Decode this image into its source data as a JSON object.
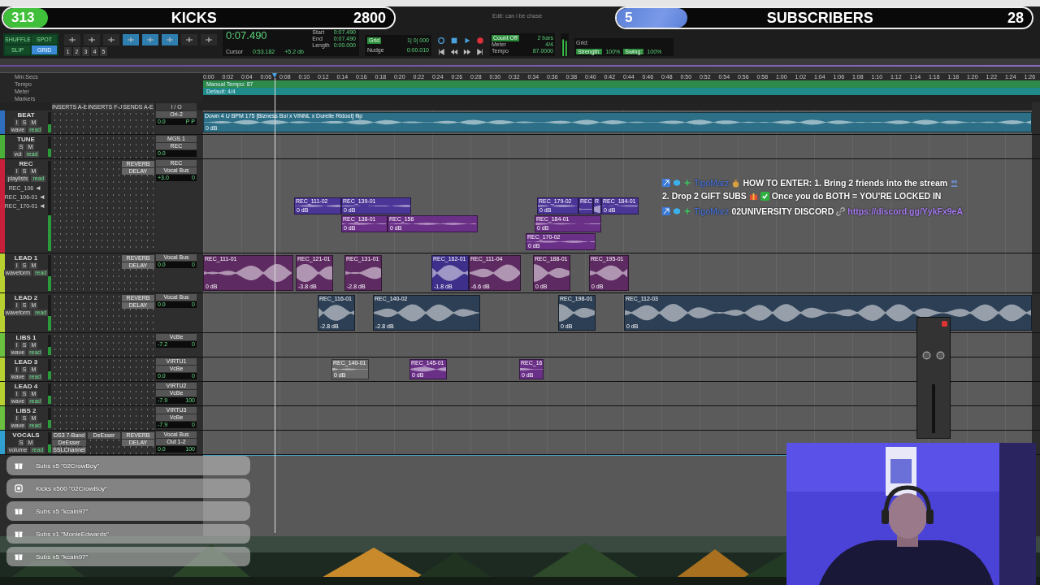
{
  "stream_goals": [
    {
      "kind": "kicks",
      "count": "313",
      "label": "KICKS",
      "target": "2800",
      "level": 0.115
    },
    {
      "kind": "subs",
      "count": "5",
      "label": "SUBSCRIBERS",
      "target": "28",
      "level": 0.17
    }
  ],
  "toolbar": {
    "window_title": "Edit: can i be chase",
    "edit_modes": [
      {
        "label": "SHUFFLE",
        "selected": false
      },
      {
        "label": "SPOT",
        "selected": false
      },
      {
        "label": "SLIP",
        "selected": false
      },
      {
        "label": "GRID",
        "selected": true
      }
    ],
    "zoom_presets": [
      "1",
      "2",
      "3",
      "4",
      "5"
    ],
    "counter": "0:07.490",
    "cursor": {
      "label": "Cursor",
      "value": "0:53.182"
    },
    "gain": "+5.2 db",
    "selection": [
      {
        "label": "Start",
        "value": "0:07.490"
      },
      {
        "label": "End",
        "value": "0:07.490"
      },
      {
        "label": "Length",
        "value": "0:00.000"
      }
    ],
    "grid": {
      "label": "Grid",
      "value": "1| 0| 000"
    },
    "nudge": {
      "label": "Nudge",
      "value": "0:00.010"
    },
    "count_off": [
      {
        "label": "Count Off",
        "value": "2 bars"
      },
      {
        "label": "Meter",
        "value": "4/4"
      },
      {
        "label": "Tempo",
        "value": "87.0000"
      }
    ],
    "groove": [
      {
        "label": "Strength:",
        "value": "100%"
      },
      {
        "label": "Swing:",
        "value": "100%"
      }
    ],
    "groove_grid": "Grid:"
  },
  "rulers": [
    {
      "label": "Min:Secs",
      "kind": "time"
    },
    {
      "label": "Tempo",
      "kind": "tempo",
      "text": "Manual Tempo: 87"
    },
    {
      "label": "Meter",
      "kind": "meter",
      "text": "Default: 4/4"
    },
    {
      "label": "Markers",
      "kind": "markers"
    }
  ],
  "ruler_ticks": [
    "0:00",
    "0:02",
    "0:04",
    "0:06",
    "0:08",
    "0:10",
    "0:12",
    "0:14",
    "0:16",
    "0:18",
    "0:20",
    "0:22",
    "0:24",
    "0:26",
    "0:28",
    "0:30",
    "0:32",
    "0:34",
    "0:36",
    "0:38",
    "0:40",
    "0:42",
    "0:44",
    "0:46",
    "0:48",
    "0:50",
    "0:52",
    "0:54",
    "0:56",
    "0:58",
    "1:00",
    "1:02",
    "1:04",
    "1:06",
    "1:08",
    "1:10",
    "1:12",
    "1:14",
    "1:16",
    "1:18",
    "1:20",
    "1:22",
    "1:24",
    "1:26"
  ],
  "columns": [
    "INSERTS A-E",
    "INSERTS F-J",
    "SENDS A-E",
    "I / O"
  ],
  "tracks": [
    {
      "name": "BEAT",
      "kind": "compact",
      "color": "#2f6fc0",
      "buttons": [
        "I",
        "S",
        "M"
      ],
      "view": "wave",
      "auto": "read",
      "io": [
        "Ori-2"
      ],
      "vol": "0.0",
      "pan": "P P",
      "clips": [
        {
          "name": "Down 4 U BPM 175 [Bizness Boi x VINNL x Durelle Ridout] flip",
          "gain": "0 dB",
          "color": "#2c6f86"
        }
      ]
    },
    {
      "name": "TUNE",
      "kind": "compact",
      "color": "#4caf3a",
      "buttons": [
        "S",
        "M"
      ],
      "view": "vol",
      "auto": "read",
      "io": [
        "MGS.1",
        "REC"
      ],
      "vol": "0.0"
    },
    {
      "name": "REC",
      "kind": "playlists",
      "color": "#c8203a",
      "buttons": [
        "I",
        "S",
        "M"
      ],
      "view": "playlists",
      "auto": "read",
      "sends": [
        "REVERB",
        "DELAY"
      ],
      "io": [
        "REC",
        "Vocal Bus"
      ],
      "vol": "+3.0",
      "pan": "0",
      "playlists": [
        "REC_106",
        "REC_106-01",
        "REC_170-01"
      ],
      "clips": [
        {
          "name": "REC_111-02",
          "gain": "0 dB",
          "color": "#4b3596"
        },
        {
          "name": "REC_139-01",
          "gain": "0 dB",
          "color": "#4b3596"
        },
        {
          "name": "REC_179-02",
          "gain": "0 dB",
          "color": "#4b3596"
        },
        {
          "name": "REC",
          "color": "#4b3596"
        },
        {
          "name": "R",
          "color": "#4b3596"
        },
        {
          "name": "REC_184-01",
          "gain": "0 dB",
          "color": "#4b3596"
        },
        {
          "name": "REC_138-01",
          "gain": "0 dB",
          "color": "#6a2f86"
        },
        {
          "name": "REC_156",
          "gain": "0 dB",
          "color": "#6a2f86"
        },
        {
          "name": "REC_184-01",
          "gain": "0 dB",
          "color": "#6a2f86"
        },
        {
          "name": "REC_170-02",
          "gain": "0 dB",
          "color": "#6a2f86"
        }
      ]
    },
    {
      "name": "LEAD 1",
      "kind": "expanded",
      "color": "#b8d030",
      "buttons": [
        "I",
        "S",
        "M"
      ],
      "view": "waveform",
      "auto": "read",
      "sends": [
        "REVERB",
        "DELAY"
      ],
      "io": [
        "Vocal Bus"
      ],
      "vol": "0.0",
      "pan": "0",
      "clips": [
        {
          "name": "REC_111-01",
          "gain": "0 dB",
          "color": "#5e2a62"
        },
        {
          "name": "REC_121-01",
          "gain": "-3.8 dB",
          "color": "#5e2a62"
        },
        {
          "name": "REC_131-01",
          "gain": "-2.8 dB",
          "color": "#5e2a62"
        },
        {
          "name": "REC_162-01",
          "gain": "-1.8 dB",
          "color": "#3e2f8a"
        },
        {
          "name": "REC_111-04",
          "gain": "-6.6 dB",
          "color": "#5e2a62"
        },
        {
          "name": "REC_188-01",
          "gain": "0 dB",
          "color": "#5e2a62"
        },
        {
          "name": "REC_195-01",
          "gain": "0 dB",
          "color": "#5e2a62"
        }
      ]
    },
    {
      "name": "LEAD 2",
      "kind": "expanded",
      "color": "#b8d030",
      "buttons": [
        "I",
        "S",
        "M"
      ],
      "view": "waveform",
      "auto": "read",
      "sends": [
        "REVERB",
        "DELAY"
      ],
      "io": [
        "Vocal Bus"
      ],
      "vol": "0.0",
      "pan": "0",
      "clips": [
        {
          "name": "REC_116-01",
          "gain": "-2.8 dB",
          "color": "#2d3f55"
        },
        {
          "name": "REC_140-02",
          "gain": "-2.8 dB",
          "color": "#2d3f55"
        },
        {
          "name": "REC_198-01",
          "gain": "0 dB",
          "color": "#2d3f55"
        },
        {
          "name": "REC_112-03",
          "gain": "0 dB",
          "color": "#2d3f55"
        }
      ]
    },
    {
      "name": "LIBS 1",
      "kind": "compact",
      "color": "#6ac040",
      "buttons": [
        "I",
        "S",
        "M"
      ],
      "view": "wave",
      "auto": "read",
      "io": [
        "VcBe"
      ],
      "vol": "-7.2",
      "pan": "0"
    },
    {
      "name": "LEAD 3",
      "kind": "compact",
      "color": "#b8d030",
      "buttons": [
        "I",
        "S",
        "M"
      ],
      "view": "wave",
      "auto": "read",
      "io": [
        "VIRTU1",
        "VcBe"
      ],
      "vol": "0.0",
      "pan": "0",
      "clips": [
        {
          "name": "REC_140-01",
          "gain": "0 dB",
          "color": "#6a6a6a"
        },
        {
          "name": "REC_145-01",
          "gain": "0 dB",
          "color": "#6a2f86"
        },
        {
          "name": "REC_16",
          "gain": "0 dB",
          "color": "#6a2f86"
        }
      ]
    },
    {
      "name": "LEAD 4",
      "kind": "compact",
      "color": "#b8d030",
      "buttons": [
        "I",
        "S",
        "M"
      ],
      "view": "wave",
      "auto": "read",
      "io": [
        "VIRTU2",
        "VcBe"
      ],
      "vol": "-7.9",
      "pan": "100"
    },
    {
      "name": "LIBS 2",
      "kind": "compact",
      "color": "#6ac040",
      "buttons": [
        "I",
        "S",
        "M"
      ],
      "view": "wave",
      "auto": "read",
      "io": [
        "VIRTU3",
        "VcBe"
      ],
      "vol": "-7.9",
      "pan": "0"
    },
    {
      "name": "VOCALS",
      "kind": "compact",
      "color": "#30a0d0",
      "buttons": [
        "S",
        "M"
      ],
      "view": "volume",
      "auto": "read",
      "inserts": [
        "DS3 7-Band",
        "DeEsser",
        "SSLChannel"
      ],
      "inserts_2": [
        "DeEsser"
      ],
      "sends": [
        "REVERB",
        "DELAY"
      ],
      "io": [
        "Vocal Bus",
        "Out 1-2"
      ],
      "vol": "0.0",
      "pan": "100"
    }
  ],
  "chat": [
    {
      "user": "TigoMarz",
      "parts": [
        {
          "kind": "moneybag"
        },
        {
          "kind": "text",
          "text": "HOW TO ENTER: 1. Bring 2 friends into the stream"
        },
        {
          "kind": "people"
        },
        {
          "kind": "text",
          "text": "2. Drop 2 GIFT SUBS"
        },
        {
          "kind": "gift"
        },
        {
          "kind": "check"
        },
        {
          "kind": "text",
          "text": "Once you do BOTH = YOU'RE LOCKED IN"
        }
      ]
    },
    {
      "user": "TigoMarz",
      "parts": [
        {
          "kind": "text",
          "text": "02UNIVERSITY DISCORD"
        },
        {
          "kind": "link-icon"
        },
        {
          "kind": "link",
          "text": "https://discord.gg/YykFx9eA"
        }
      ]
    }
  ],
  "alerts": [
    {
      "kind": "gift",
      "text": "Subs x5 \"02CrowBoy\""
    },
    {
      "kind": "kick",
      "text": "Kicks x500 \"02CrowBoy\""
    },
    {
      "kind": "gift",
      "text": "Subs x5 \"kcain97\""
    },
    {
      "kind": "gift",
      "text": "Subs x1 \"MonieEdwards\""
    },
    {
      "kind": "gift",
      "text": "Subs x5 \"kcain97\""
    }
  ]
}
